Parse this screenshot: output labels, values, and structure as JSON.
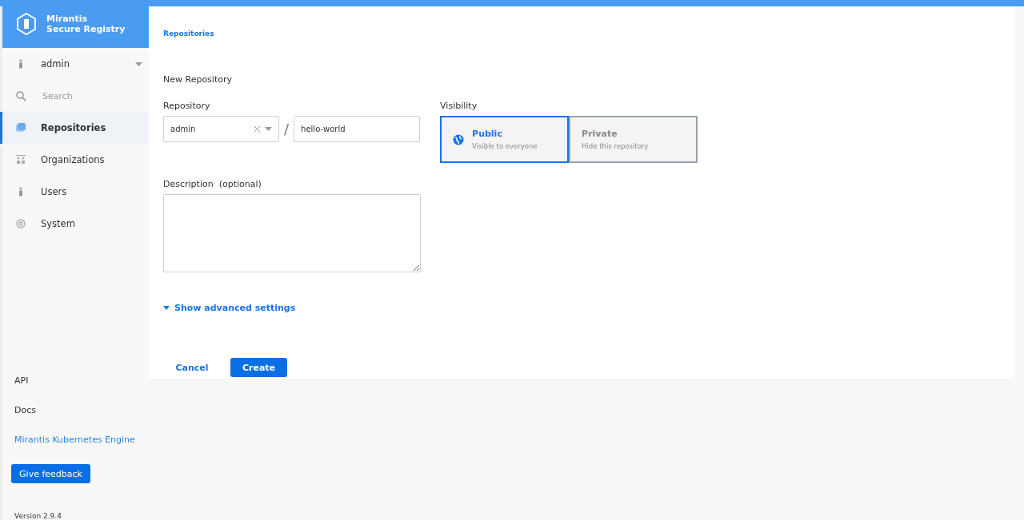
{
  "brand": {
    "line1": "Mirantis",
    "line2": "Secure Registry"
  },
  "sidebar": {
    "user": {
      "name": "admin"
    },
    "search": {
      "placeholder": "Search"
    },
    "items": [
      {
        "label": "Repositories",
        "kind": "repos",
        "selected": true
      },
      {
        "label": "Organizations",
        "kind": "orgs",
        "selected": false
      },
      {
        "label": "Users",
        "kind": "user",
        "selected": false
      },
      {
        "label": "System",
        "kind": "gear",
        "selected": false
      }
    ],
    "links": [
      {
        "label": "API",
        "kind": "plain"
      },
      {
        "label": "Docs",
        "kind": "plain"
      },
      {
        "label": "Mirantis Kubernetes Engine",
        "kind": "accent"
      }
    ],
    "feedback_button": "Give feedback",
    "version": "Version 2.9.4"
  },
  "breadcrumb": "Repositories",
  "form": {
    "title": "New Repository",
    "repository_label": "Repository",
    "namespace": "admin",
    "separator": "/",
    "name": "hello-world",
    "visibility_label": "Visibility",
    "visibility_options": [
      {
        "title": "Public",
        "subtitle": "Visible to everyone",
        "selected": true
      },
      {
        "title": "Private",
        "subtitle": "Hide this repository",
        "selected": false
      }
    ],
    "description_label": "Description  (optional)",
    "advanced_toggle": {
      "label": "Show advanced settings",
      "expanded": false
    },
    "cancel": "Cancel",
    "create": "Create"
  }
}
